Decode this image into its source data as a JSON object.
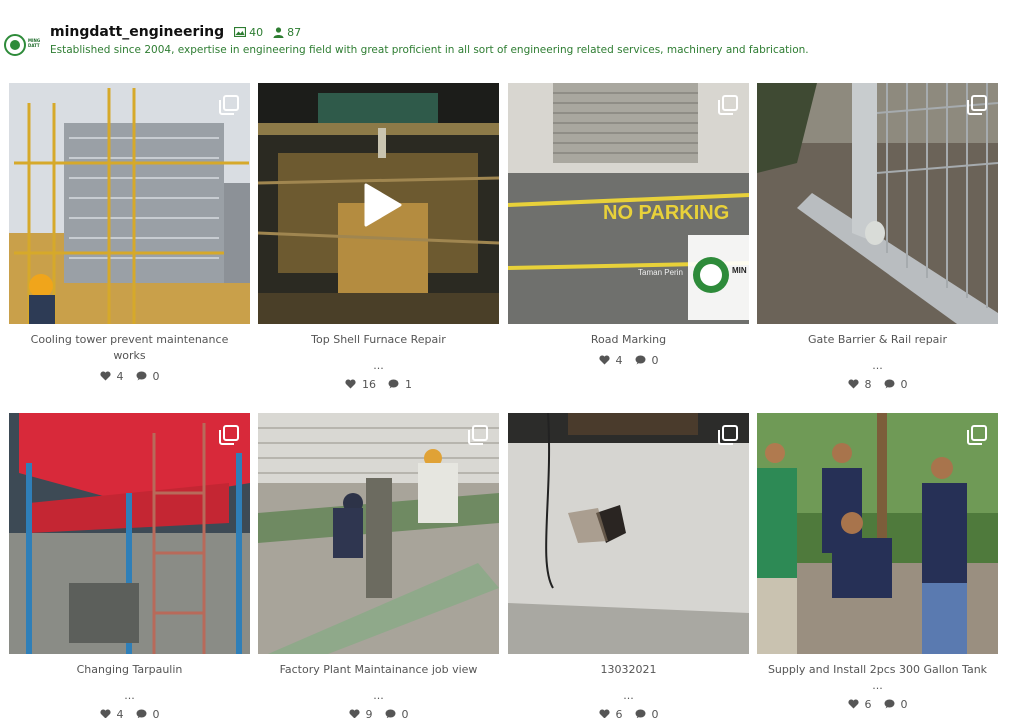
{
  "profile": {
    "username": "mingdatt_engineering",
    "logo_text": "MING DATT",
    "posts_count": "40",
    "followers_count": "87",
    "bio": "Established since 2004, expertise in engineering field with great proficient in all sort of engineering related services, machinery and fabrication."
  },
  "colors": {
    "accent": "#2e7d32"
  },
  "posts": [
    {
      "caption": "Cooling tower prevent maintenance works",
      "more": "",
      "likes": "4",
      "comments": "0",
      "type": "carousel"
    },
    {
      "caption": "Top Shell Furnace Repair",
      "more": "...",
      "likes": "16",
      "comments": "1",
      "type": "video"
    },
    {
      "caption": "Road Marking",
      "more": "",
      "likes": "4",
      "comments": "0",
      "type": "carousel",
      "overlay_text": "NO PARKING",
      "watermark_text": "Taman Perin",
      "watermark_brand": "MIN DAT"
    },
    {
      "caption": "Gate Barrier & Rail repair",
      "more": "...",
      "likes": "8",
      "comments": "0",
      "type": "carousel"
    },
    {
      "caption": "Changing Tarpaulin",
      "more": "...",
      "likes": "4",
      "comments": "0",
      "type": "carousel"
    },
    {
      "caption": "Factory Plant Maintainance job view",
      "more": "...",
      "likes": "9",
      "comments": "0",
      "type": "carousel"
    },
    {
      "caption": "13032021",
      "more": "...",
      "likes": "6",
      "comments": "0",
      "type": "carousel"
    },
    {
      "caption": "Supply and Install 2pcs 300 Gallon Tank",
      "more": "...",
      "likes": "6",
      "comments": "0",
      "type": "carousel"
    }
  ]
}
